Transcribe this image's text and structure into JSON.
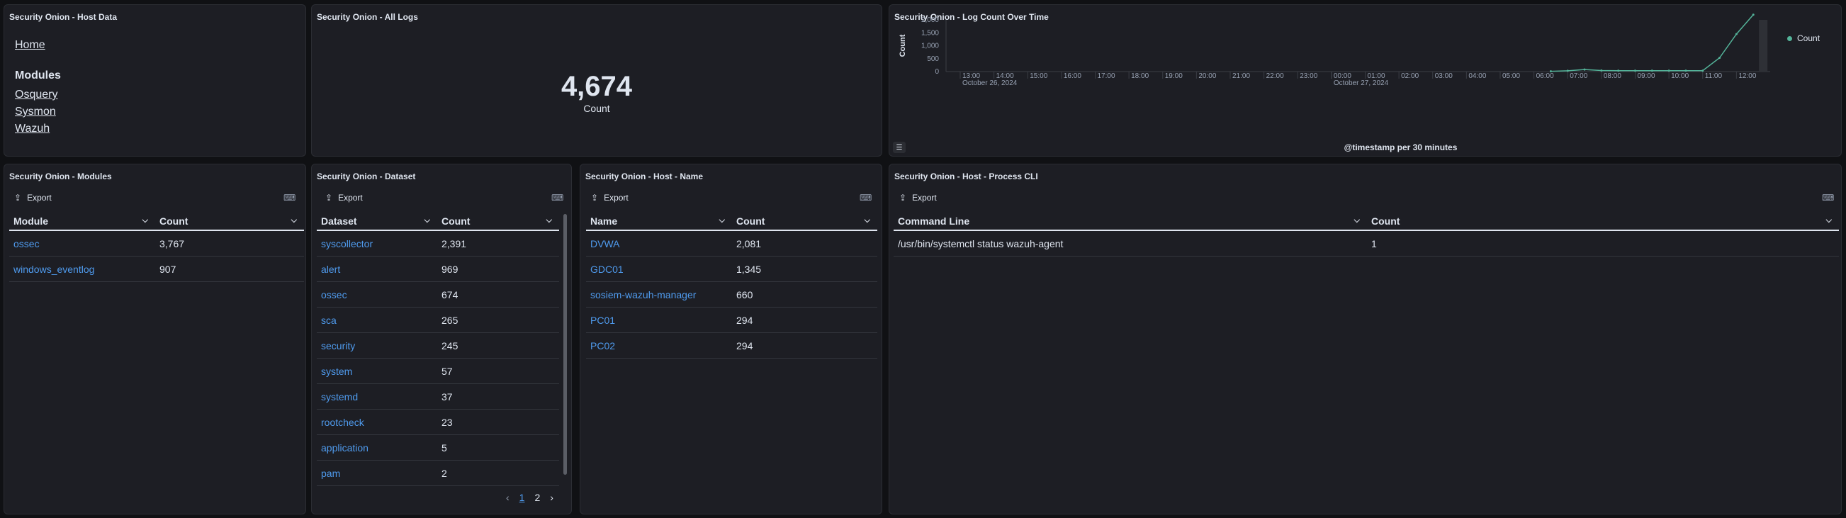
{
  "host_data": {
    "title": "Security Onion - Host Data",
    "home": "Home",
    "modules_heading": "Modules",
    "modules": [
      "Osquery",
      "Sysmon",
      "Wazuh"
    ]
  },
  "all_logs": {
    "title": "Security Onion - All Logs",
    "value": "4,674",
    "label": "Count"
  },
  "log_count_chart": {
    "title": "Security Onion - Log Count Over Time",
    "legend_label": "Count",
    "series_color": "#54b399"
  },
  "chart_data": {
    "type": "line",
    "title": "Security Onion - Log Count Over Time",
    "xlabel": "@timestamp per 30 minutes",
    "ylabel": "Count",
    "ylim": [
      0,
      2000
    ],
    "yticks": [
      "0",
      "500",
      "1,000",
      "1,500",
      "2,000"
    ],
    "xticks": [
      "13:00",
      "14:00",
      "15:00",
      "16:00",
      "17:00",
      "18:00",
      "19:00",
      "20:00",
      "21:00",
      "22:00",
      "23:00",
      "00:00",
      "01:00",
      "02:00",
      "03:00",
      "04:00",
      "05:00",
      "06:00",
      "07:00",
      "08:00",
      "09:00",
      "10:00",
      "11:00",
      "12:00"
    ],
    "date_labels": [
      {
        "under": "13:00",
        "text": "October 26, 2024"
      },
      {
        "under": "00:00",
        "text": "October 27, 2024"
      }
    ],
    "legend_position": "top-right",
    "grid": false,
    "series": [
      {
        "name": "Count",
        "x": [
          "06:30",
          "07:00",
          "07:30",
          "08:00",
          "08:30",
          "09:00",
          "09:30",
          "10:00",
          "10:30",
          "11:00",
          "11:30",
          "12:00",
          "12:30"
        ],
        "values": [
          10,
          30,
          80,
          40,
          35,
          35,
          35,
          35,
          35,
          35,
          530,
          1450,
          2200
        ]
      }
    ]
  },
  "modules_table": {
    "title": "Security Onion - Modules",
    "export": "Export",
    "columns": [
      "Module",
      "Count"
    ],
    "rows": [
      [
        "ossec",
        "3,767"
      ],
      [
        "windows_eventlog",
        "907"
      ]
    ]
  },
  "dataset_table": {
    "title": "Security Onion - Dataset",
    "export": "Export",
    "columns": [
      "Dataset",
      "Count"
    ],
    "rows": [
      [
        "syscollector",
        "2,391"
      ],
      [
        "alert",
        "969"
      ],
      [
        "ossec",
        "674"
      ],
      [
        "sca",
        "265"
      ],
      [
        "security",
        "245"
      ],
      [
        "system",
        "57"
      ],
      [
        "systemd",
        "37"
      ],
      [
        "rootcheck",
        "23"
      ],
      [
        "application",
        "5"
      ],
      [
        "pam",
        "2"
      ]
    ],
    "pages": [
      "1",
      "2"
    ]
  },
  "hostname_table": {
    "title": "Security Onion - Host - Name",
    "export": "Export",
    "columns": [
      "Name",
      "Count"
    ],
    "rows": [
      [
        "DVWA",
        "2,081"
      ],
      [
        "GDC01",
        "1,345"
      ],
      [
        "sosiem-wazuh-manager",
        "660"
      ],
      [
        "PC01",
        "294"
      ],
      [
        "PC02",
        "294"
      ]
    ]
  },
  "process_table": {
    "title": "Security Onion - Host - Process CLI",
    "export": "Export",
    "columns": [
      "Command Line",
      "Count"
    ],
    "rows": [
      [
        "/usr/bin/systemctl status wazuh-agent",
        "1"
      ]
    ]
  }
}
